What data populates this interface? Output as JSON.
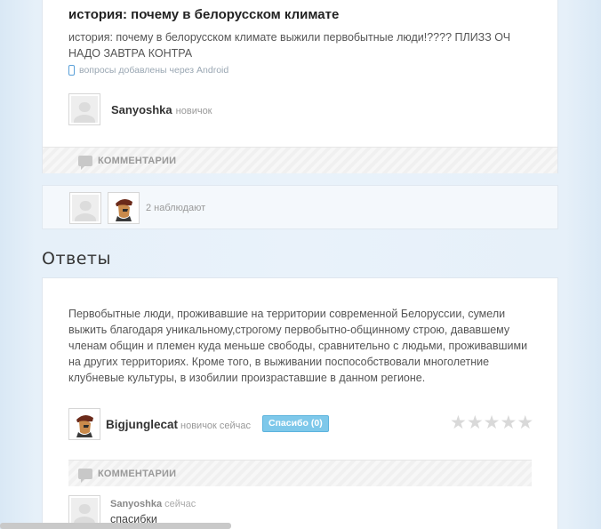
{
  "question": {
    "title": "история: почему в белорусском климате",
    "body": "история: почему в белорусском климате выжили первобытные люди!???? ПЛИЗЗ ОЧ НАДО ЗАВТРА КОНТРА",
    "meta": "вопросы добавлены через Android",
    "author": {
      "name": "Sanyoshka",
      "rank": "новичок"
    },
    "comments_label": "КОММЕНТАРИИ"
  },
  "watchers": {
    "text": "2 наблюдают"
  },
  "answers": {
    "heading": "Ответы",
    "items": [
      {
        "body": "Первобытные люди, проживавшие на территории современной Белоруссии, сумели выжить благодаря уникальному,строгому первобытно-общинному строю, дававшему членам общин и племен куда меньше свободы, сравнительно с людьми, проживавшими на других территориях. Кроме того, в выживании поспособствовали многолетние клубневые культуры, в изобилии произраставшие в данном регионе.",
        "author": {
          "name": "Bigjunglecat",
          "rank": "новичок",
          "time": "сейчас"
        },
        "thanks_label": "Спасибо (0)",
        "rating": 0,
        "comments_label": "КОММЕНТАРИИ",
        "comment": {
          "author": "Sanyoshka",
          "time": "сейчас",
          "text": "спасибки"
        }
      }
    ]
  },
  "icons": {
    "android": "phone-icon",
    "comments": "speech-bubble-icon",
    "rating": "star-icon"
  },
  "colors": {
    "accent": "#7ec8ea",
    "background": "#e6f0f9"
  }
}
